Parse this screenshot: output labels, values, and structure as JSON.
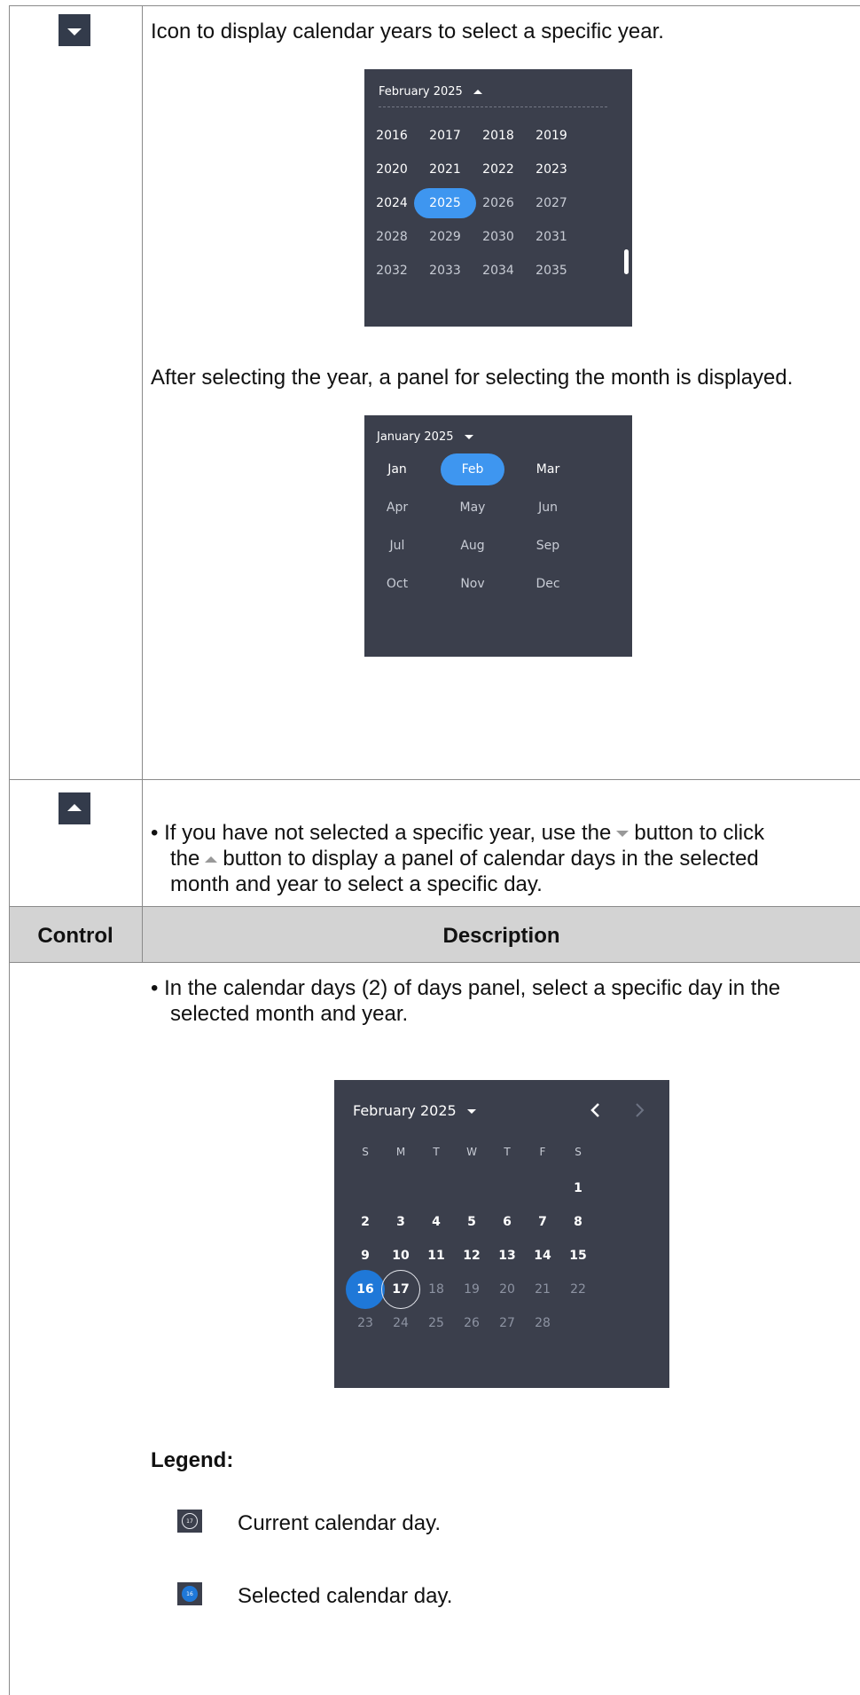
{
  "row1": {
    "control_icon": "caret-down-icon",
    "intro": "Icon to display calendar years to select a specific year.",
    "year_panel": {
      "header": "February 2025",
      "rows": [
        [
          "2016",
          "2017",
          "2018",
          "2019"
        ],
        [
          "2020",
          "2021",
          "2022",
          "2023"
        ],
        [
          "2024",
          "2025",
          "2026",
          "2027"
        ],
        [
          "2028",
          "2029",
          "2030",
          "2031"
        ],
        [
          "2032",
          "2033",
          "2034",
          "2035"
        ]
      ],
      "selected": "2025"
    },
    "after_text": "After selecting the year, a panel for selecting the month is displayed.",
    "month_panel": {
      "header": "January 2025",
      "months": [
        "Jan",
        "Feb",
        "Mar",
        "Apr",
        "May",
        "Jun",
        "Jul",
        "Aug",
        "Sep",
        "Oct",
        "Nov",
        "Dec"
      ],
      "selected": "Feb"
    }
  },
  "row2": {
    "control_icon": "caret-up-icon",
    "bullet_1": "• If you have not selected a specific year, use the",
    "bullet_2": "button to click",
    "bullet_3": "the",
    "bullet_4": "button to display a panel of calendar days in the selected",
    "bullet_5": "month and year to select a specific day."
  },
  "table_header": {
    "control": "Control",
    "description": "Description"
  },
  "row3": {
    "bullet_line1": "• In the calendar days (2) of days panel, select a specific day in the",
    "bullet_line2": "selected month and year.",
    "day_panel": {
      "header": "February 2025",
      "weekdays": [
        "S",
        "M",
        "T",
        "W",
        "T",
        "F",
        "S"
      ],
      "weeks": [
        [
          "",
          "",
          "",
          "",
          "",
          "",
          "1"
        ],
        [
          "2",
          "3",
          "4",
          "5",
          "6",
          "7",
          "8"
        ],
        [
          "9",
          "10",
          "11",
          "12",
          "13",
          "14",
          "15"
        ],
        [
          "16",
          "17",
          "18",
          "19",
          "20",
          "21",
          "22"
        ],
        [
          "23",
          "24",
          "25",
          "26",
          "27",
          "28",
          ""
        ]
      ],
      "selected_day": "16",
      "current_day": "17"
    },
    "legend_title": "Legend:",
    "legend_current_num": "17",
    "legend_current": "Current calendar day.",
    "legend_selected_num": "16",
    "legend_selected": "Selected calendar day."
  },
  "colors": {
    "panel_bg": "#3b3f4c",
    "accent": "#3e96f0",
    "selected_day": "#1f78d8",
    "header_bg": "#d3d3d3"
  }
}
